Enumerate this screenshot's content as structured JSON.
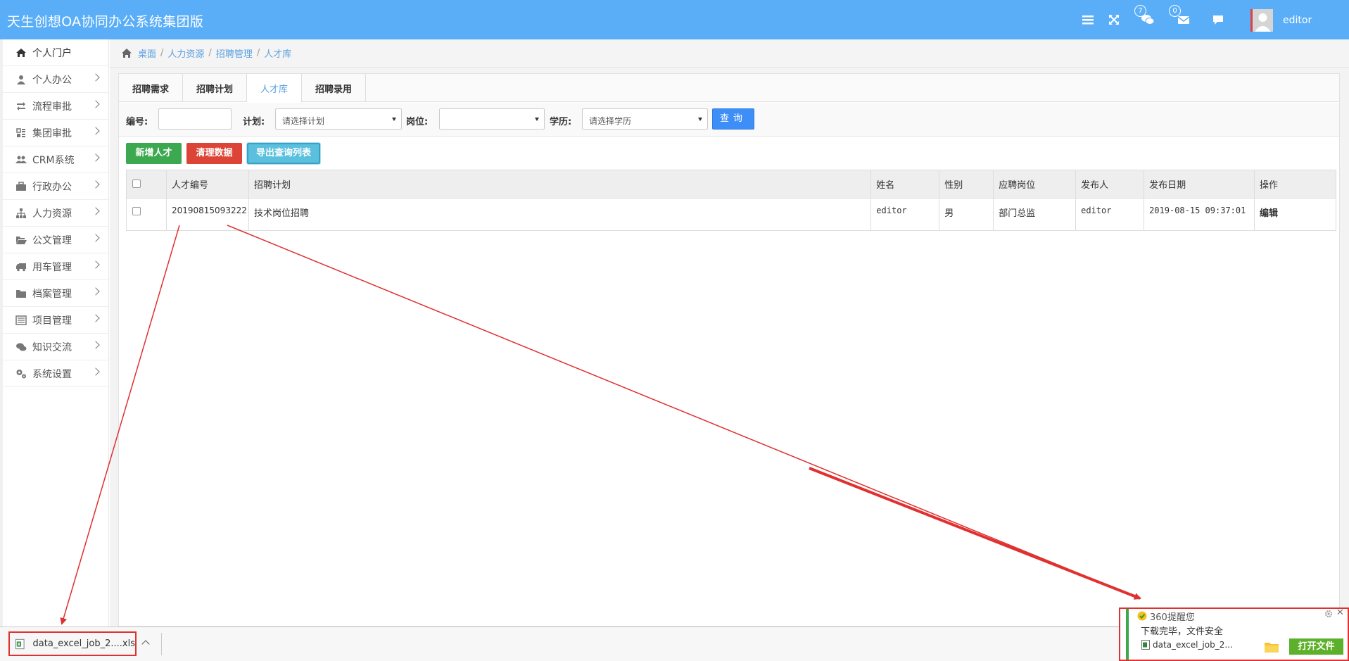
{
  "app": {
    "title": "天生创想OA协同办公系统集团版"
  },
  "topbar": {
    "icons": [
      "menu-icon",
      "fullscreen-icon",
      "chat-icon",
      "mail-icon",
      "comment-icon"
    ],
    "chat_badge": "7",
    "mail_badge": "0",
    "username": "editor"
  },
  "sidebar": {
    "items": [
      {
        "label": "个人门户",
        "icon": "home-icon"
      },
      {
        "label": "个人办公",
        "icon": "user-icon"
      },
      {
        "label": "流程审批",
        "icon": "retweet-icon"
      },
      {
        "label": "集团审批",
        "icon": "grid-icon"
      },
      {
        "label": "CRM系统",
        "icon": "users-icon"
      },
      {
        "label": "行政办公",
        "icon": "briefcase-icon"
      },
      {
        "label": "人力资源",
        "icon": "sitemap-icon"
      },
      {
        "label": "公文管理",
        "icon": "folder-open-icon"
      },
      {
        "label": "用车管理",
        "icon": "truck-icon"
      },
      {
        "label": "档案管理",
        "icon": "folder-icon"
      },
      {
        "label": "项目管理",
        "icon": "list-icon"
      },
      {
        "label": "知识交流",
        "icon": "comments-icon"
      },
      {
        "label": "系统设置",
        "icon": "cogs-icon"
      }
    ]
  },
  "breadcrumb": [
    "桌面",
    "人力资源",
    "招聘管理",
    "人才库"
  ],
  "tabs": [
    "招聘需求",
    "招聘计划",
    "人才库",
    "招聘录用"
  ],
  "filter": {
    "id_label": "编号:",
    "id_value": "",
    "plan_label": "计划:",
    "plan_value": "请选择计划",
    "post_label": "岗位:",
    "post_value": "",
    "edu_label": "学历:",
    "edu_value": "请选择学历",
    "query_label": "查询"
  },
  "actions": {
    "add": "新增人才",
    "clear": "清理数据",
    "export": "导出查询列表"
  },
  "table": {
    "headers": [
      "",
      "人才编号",
      "招聘计划",
      "姓名",
      "性别",
      "应聘岗位",
      "发布人",
      "发布日期",
      "操作"
    ],
    "rows": [
      {
        "id": "20190815093222",
        "plan": "技术岗位招聘",
        "name": "editor",
        "gender": "男",
        "post": "部门总监",
        "publisher": "editor",
        "date": "2019-08-15 09:37:01",
        "op": "编辑"
      }
    ]
  },
  "download_bar": {
    "file": "data_excel_job_2....xls"
  },
  "popup": {
    "title": "360提醒您",
    "message": "下载完毕，文件安全",
    "file": "data_excel_job_2...",
    "open": "打开文件"
  },
  "colors": {
    "topbar": "#5aaef8",
    "accent": "#5aa0e0",
    "annotation": "#e03030"
  }
}
